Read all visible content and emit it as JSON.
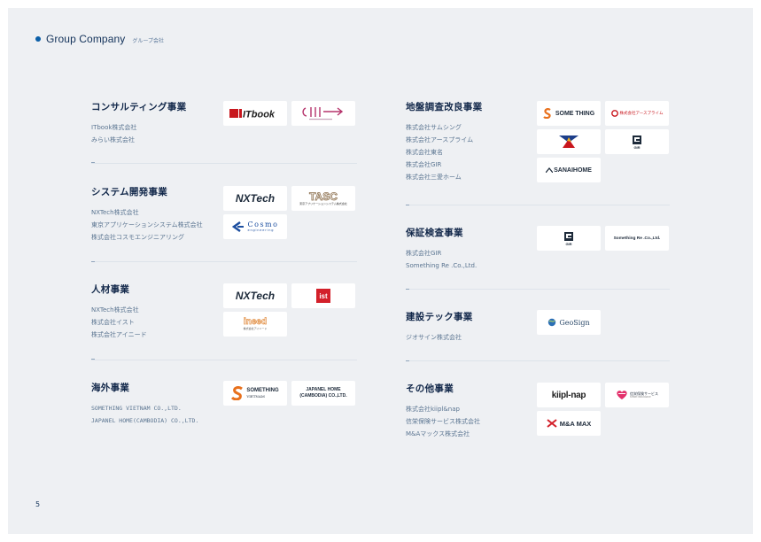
{
  "header": {
    "title": "Group Company",
    "subtitle": "グループ会社"
  },
  "page_number": "5",
  "sections": {
    "consulting": {
      "title": "コンサルティング事業",
      "companies": [
        "ITbook株式会社",
        "みらい株式会社"
      ]
    },
    "system": {
      "title": "システム開発事業",
      "companies": [
        "NXTech株式会社",
        "東京アプリケーションシステム株式会社",
        "株式会社コスモエンジニアリング"
      ]
    },
    "hr": {
      "title": "人材事業",
      "companies": [
        "NXTech株式会社",
        "株式会社イスト",
        "株式会社アイニード"
      ]
    },
    "overseas": {
      "title": "海外事業",
      "companies": [
        "SOMETHING VIETNAM CO.,LTD.",
        "JAPANEL HOME(CAMBODIA) CO.,LTD."
      ]
    },
    "ground": {
      "title": "地盤調査改良事業",
      "companies": [
        "株式会社サムシング",
        "株式会社アースプライム",
        "株式会社東名",
        "株式会社GIR",
        "株式会社三愛ホーム"
      ]
    },
    "warranty": {
      "title": "保証検査事業",
      "companies": [
        "株式会社GIR",
        "Something Re .Co.,Ltd."
      ]
    },
    "contech": {
      "title": "建設テック事業",
      "companies": [
        "ジオサイン株式会社"
      ]
    },
    "other": {
      "title": "その他事業",
      "companies": [
        "株式会社kiipl&nap",
        "信栄保険サービス株式会社",
        "M&Aマックス株式会社"
      ]
    }
  },
  "logos": {
    "itbook": "ITbook",
    "nxtech": "NXTech",
    "tasc": "TASC",
    "tasc_sub": "東京アプリケーションシステム株式会社",
    "cosmo": "Cosmo",
    "cosmo_sub": "engineering",
    "ist": "ist",
    "ineed": "ineed",
    "ineed_sub": "株式会社アイニード",
    "something_vn": "SOMETHING",
    "something_vn_sub": "VIETNAM",
    "japanel_1": "JAPANEL HOME",
    "japanel_2": "(CAMBODIA) CO.,LTD.",
    "something": "SOME THING",
    "earthprime": "株式会社アースプライム",
    "sanai": "SANAIHOME",
    "gir": "GIR",
    "something_re": "Something Re .Co.,Ltd.",
    "geosign": "GeoSign",
    "kiipl": "kiipl-nap",
    "shinei": "信栄保険サービス",
    "shinei_sub": "SHINEI INSURANCE",
    "mamax": "M&A MAX"
  },
  "colors": {
    "accent": "#0b5fa8",
    "heading": "#12284a",
    "body": "#5b7591",
    "background": "#eef0f3"
  }
}
